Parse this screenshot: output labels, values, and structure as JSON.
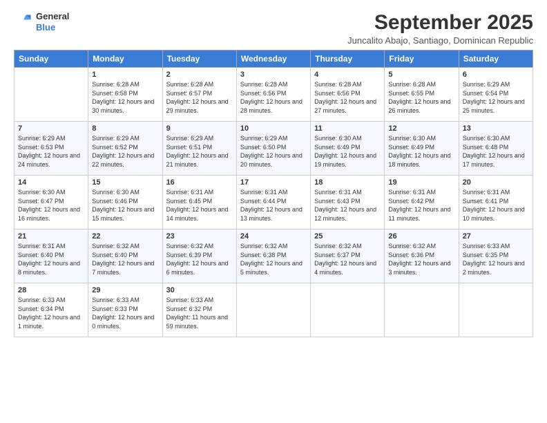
{
  "logo": {
    "general": "General",
    "blue": "Blue"
  },
  "title": "September 2025",
  "subtitle": "Juncalito Abajo, Santiago, Dominican Republic",
  "days": [
    "Sunday",
    "Monday",
    "Tuesday",
    "Wednesday",
    "Thursday",
    "Friday",
    "Saturday"
  ],
  "weeks": [
    [
      {
        "day": "",
        "sunrise": "",
        "sunset": "",
        "daylight": ""
      },
      {
        "day": "1",
        "sunrise": "Sunrise: 6:28 AM",
        "sunset": "Sunset: 6:58 PM",
        "daylight": "Daylight: 12 hours and 30 minutes."
      },
      {
        "day": "2",
        "sunrise": "Sunrise: 6:28 AM",
        "sunset": "Sunset: 6:57 PM",
        "daylight": "Daylight: 12 hours and 29 minutes."
      },
      {
        "day": "3",
        "sunrise": "Sunrise: 6:28 AM",
        "sunset": "Sunset: 6:56 PM",
        "daylight": "Daylight: 12 hours and 28 minutes."
      },
      {
        "day": "4",
        "sunrise": "Sunrise: 6:28 AM",
        "sunset": "Sunset: 6:56 PM",
        "daylight": "Daylight: 12 hours and 27 minutes."
      },
      {
        "day": "5",
        "sunrise": "Sunrise: 6:28 AM",
        "sunset": "Sunset: 6:55 PM",
        "daylight": "Daylight: 12 hours and 26 minutes."
      },
      {
        "day": "6",
        "sunrise": "Sunrise: 6:29 AM",
        "sunset": "Sunset: 6:54 PM",
        "daylight": "Daylight: 12 hours and 25 minutes."
      }
    ],
    [
      {
        "day": "7",
        "sunrise": "Sunrise: 6:29 AM",
        "sunset": "Sunset: 6:53 PM",
        "daylight": "Daylight: 12 hours and 24 minutes."
      },
      {
        "day": "8",
        "sunrise": "Sunrise: 6:29 AM",
        "sunset": "Sunset: 6:52 PM",
        "daylight": "Daylight: 12 hours and 22 minutes."
      },
      {
        "day": "9",
        "sunrise": "Sunrise: 6:29 AM",
        "sunset": "Sunset: 6:51 PM",
        "daylight": "Daylight: 12 hours and 21 minutes."
      },
      {
        "day": "10",
        "sunrise": "Sunrise: 6:29 AM",
        "sunset": "Sunset: 6:50 PM",
        "daylight": "Daylight: 12 hours and 20 minutes."
      },
      {
        "day": "11",
        "sunrise": "Sunrise: 6:30 AM",
        "sunset": "Sunset: 6:49 PM",
        "daylight": "Daylight: 12 hours and 19 minutes."
      },
      {
        "day": "12",
        "sunrise": "Sunrise: 6:30 AM",
        "sunset": "Sunset: 6:49 PM",
        "daylight": "Daylight: 12 hours and 18 minutes."
      },
      {
        "day": "13",
        "sunrise": "Sunrise: 6:30 AM",
        "sunset": "Sunset: 6:48 PM",
        "daylight": "Daylight: 12 hours and 17 minutes."
      }
    ],
    [
      {
        "day": "14",
        "sunrise": "Sunrise: 6:30 AM",
        "sunset": "Sunset: 6:47 PM",
        "daylight": "Daylight: 12 hours and 16 minutes."
      },
      {
        "day": "15",
        "sunrise": "Sunrise: 6:30 AM",
        "sunset": "Sunset: 6:46 PM",
        "daylight": "Daylight: 12 hours and 15 minutes."
      },
      {
        "day": "16",
        "sunrise": "Sunrise: 6:31 AM",
        "sunset": "Sunset: 6:45 PM",
        "daylight": "Daylight: 12 hours and 14 minutes."
      },
      {
        "day": "17",
        "sunrise": "Sunrise: 6:31 AM",
        "sunset": "Sunset: 6:44 PM",
        "daylight": "Daylight: 12 hours and 13 minutes."
      },
      {
        "day": "18",
        "sunrise": "Sunrise: 6:31 AM",
        "sunset": "Sunset: 6:43 PM",
        "daylight": "Daylight: 12 hours and 12 minutes."
      },
      {
        "day": "19",
        "sunrise": "Sunrise: 6:31 AM",
        "sunset": "Sunset: 6:42 PM",
        "daylight": "Daylight: 12 hours and 11 minutes."
      },
      {
        "day": "20",
        "sunrise": "Sunrise: 6:31 AM",
        "sunset": "Sunset: 6:41 PM",
        "daylight": "Daylight: 12 hours and 10 minutes."
      }
    ],
    [
      {
        "day": "21",
        "sunrise": "Sunrise: 6:31 AM",
        "sunset": "Sunset: 6:40 PM",
        "daylight": "Daylight: 12 hours and 8 minutes."
      },
      {
        "day": "22",
        "sunrise": "Sunrise: 6:32 AM",
        "sunset": "Sunset: 6:40 PM",
        "daylight": "Daylight: 12 hours and 7 minutes."
      },
      {
        "day": "23",
        "sunrise": "Sunrise: 6:32 AM",
        "sunset": "Sunset: 6:39 PM",
        "daylight": "Daylight: 12 hours and 6 minutes."
      },
      {
        "day": "24",
        "sunrise": "Sunrise: 6:32 AM",
        "sunset": "Sunset: 6:38 PM",
        "daylight": "Daylight: 12 hours and 5 minutes."
      },
      {
        "day": "25",
        "sunrise": "Sunrise: 6:32 AM",
        "sunset": "Sunset: 6:37 PM",
        "daylight": "Daylight: 12 hours and 4 minutes."
      },
      {
        "day": "26",
        "sunrise": "Sunrise: 6:32 AM",
        "sunset": "Sunset: 6:36 PM",
        "daylight": "Daylight: 12 hours and 3 minutes."
      },
      {
        "day": "27",
        "sunrise": "Sunrise: 6:33 AM",
        "sunset": "Sunset: 6:35 PM",
        "daylight": "Daylight: 12 hours and 2 minutes."
      }
    ],
    [
      {
        "day": "28",
        "sunrise": "Sunrise: 6:33 AM",
        "sunset": "Sunset: 6:34 PM",
        "daylight": "Daylight: 12 hours and 1 minute."
      },
      {
        "day": "29",
        "sunrise": "Sunrise: 6:33 AM",
        "sunset": "Sunset: 6:33 PM",
        "daylight": "Daylight: 12 hours and 0 minutes."
      },
      {
        "day": "30",
        "sunrise": "Sunrise: 6:33 AM",
        "sunset": "Sunset: 6:32 PM",
        "daylight": "Daylight: 11 hours and 59 minutes."
      },
      {
        "day": "",
        "sunrise": "",
        "sunset": "",
        "daylight": ""
      },
      {
        "day": "",
        "sunrise": "",
        "sunset": "",
        "daylight": ""
      },
      {
        "day": "",
        "sunrise": "",
        "sunset": "",
        "daylight": ""
      },
      {
        "day": "",
        "sunrise": "",
        "sunset": "",
        "daylight": ""
      }
    ]
  ]
}
